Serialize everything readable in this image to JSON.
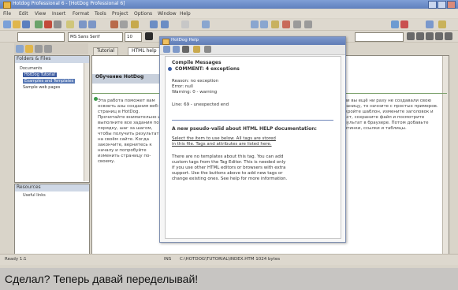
{
  "window": {
    "title": "Hotdog Professional 6 - [HotDog Professional 6]",
    "menu": [
      "File",
      "Edit",
      "View",
      "Insert",
      "Format",
      "Tools",
      "Project",
      "Options",
      "Window",
      "Help"
    ]
  },
  "toolbar": {
    "combo_left": "",
    "font_combo": "MS Sans Serif",
    "size_combo": "10",
    "right_combo": ""
  },
  "left_pane": {
    "header": "Folders & Files",
    "items": [
      {
        "label": "Documents",
        "selected": false
      },
      {
        "label": "HotDog Tutorial",
        "selected": true
      },
      {
        "label": "Examples and Templates",
        "selected": false
      },
      {
        "label": "Sample web pages",
        "selected": false
      }
    ],
    "bottom_header": "Resources",
    "bottom_items": [
      "Useful links"
    ]
  },
  "doc": {
    "tabs": [
      "Tutorial",
      "HTML help"
    ],
    "heading": "Обучение HotDog",
    "left_text": "Эта работа поможет вам освоить азы создания веб-страниц в HotDog. Прочитайте внимательно и выполните все задания по порядку, шаг за шагом, чтобы получить результат на своём сайте. Когда закончите, вернитесь к началу и попробуйте изменить страницу по-своему.",
    "right_text": "Если вы ещё ни разу не создавали свою страницу, то начните с простых примеров. Откройте шаблон, измените заголовок и текст, сохраните файл и посмотрите результат в браузере. Потом добавьте картинки, ссылки и таблицы."
  },
  "dialog": {
    "title": "HotDog Help",
    "lines": [
      {
        "text": "Compile Messages",
        "bold": true
      },
      {
        "text": "COMMENT: 4 exceptions",
        "bold": true
      },
      {
        "text": "Reason: no exception",
        "bold": false
      },
      {
        "text": "Error: null",
        "bold": false
      },
      {
        "text": "Warning: 0 - warning",
        "bold": false
      },
      {
        "text": "Line: 69 - unexpected end",
        "bold": false
      },
      {
        "text": "A new pseudo-valid about HTML HELP documentation:",
        "bold": true
      },
      {
        "text": "Select the item to use below. All tags are stored",
        "bold": false
      },
      {
        "text": "in this file. Tags and attributes are listed here.",
        "bold": false
      },
      {
        "text": "There are no templates about this tag. You can add",
        "bold": false
      },
      {
        "text": "custom tags from the Tag Editor. This is needed only",
        "bold": false
      },
      {
        "text": "if you use other HTML editors or browsers with extra",
        "bold": false
      },
      {
        "text": "support. Use the buttons above to add new tags or",
        "bold": false
      },
      {
        "text": "change existing ones. See help for more information.",
        "bold": false
      }
    ]
  },
  "statusbar": {
    "left": "Ready   1:1",
    "mid": "INS",
    "right": "C:\\HOTDOG\\TUTORIAL\\INDEX.HTM   1024 bytes"
  },
  "caption": "Сделал? Теперь давай переделывай!",
  "colors": {
    "title_bar": "#5f80bd",
    "selection": "#3b5aa0",
    "caption_bg": "#c7c5c2"
  }
}
